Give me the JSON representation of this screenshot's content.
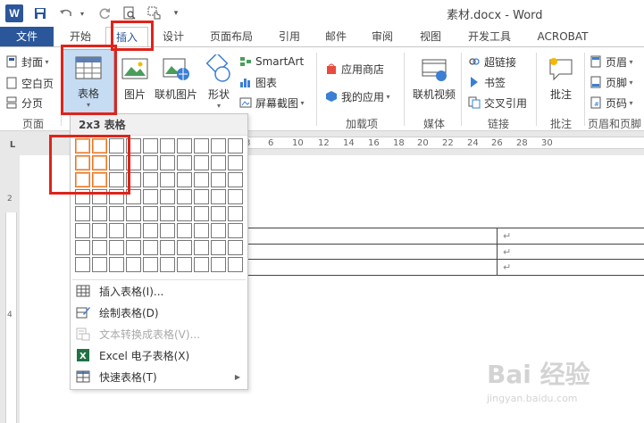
{
  "titlebar": {
    "logo": "W",
    "title": "素材.docx - Word",
    "qat": [
      "save-icon",
      "undo-icon",
      "redo-icon",
      "print-preview-icon",
      "touch-mode-icon",
      "customize-qat-icon"
    ]
  },
  "tabs": [
    {
      "id": "file",
      "label": "文件"
    },
    {
      "id": "home",
      "label": "开始"
    },
    {
      "id": "insert",
      "label": "插入"
    },
    {
      "id": "design",
      "label": "设计"
    },
    {
      "id": "layout",
      "label": "页面布局"
    },
    {
      "id": "references",
      "label": "引用"
    },
    {
      "id": "mailings",
      "label": "邮件"
    },
    {
      "id": "review",
      "label": "审阅"
    },
    {
      "id": "view",
      "label": "视图"
    },
    {
      "id": "developer",
      "label": "开发工具"
    },
    {
      "id": "acrobat",
      "label": "ACROBAT"
    }
  ],
  "ribbon": {
    "pages": {
      "cover": "封面",
      "blank": "空白页",
      "break": "分页",
      "label": "页面"
    },
    "table": {
      "label": "表格"
    },
    "illustrations": {
      "picture": "图片",
      "online_picture": "联机图片",
      "shapes": "形状",
      "smartart": "SmartArt",
      "chart": "图表",
      "screenshot": "屏幕截图"
    },
    "addins": {
      "store": "应用商店",
      "my_apps": "我的应用",
      "label": "加载项"
    },
    "media": {
      "online_video": "联机视频",
      "label": "媒体"
    },
    "links": {
      "hyperlink": "超链接",
      "bookmark": "书签",
      "cross_ref": "交叉引用",
      "label": "链接"
    },
    "comments": {
      "comment": "批注",
      "label": "批注"
    },
    "header_footer": {
      "header": "页眉",
      "footer": "页脚",
      "page_number": "页码",
      "label": "页眉和页脚"
    }
  },
  "dropdown": {
    "header": "2x3 表格",
    "rows_selected": 3,
    "cols_selected": 2,
    "items": [
      {
        "label": "插入表格(I)...",
        "icon": "insert-table-icon",
        "disabled": false,
        "submenu": false
      },
      {
        "label": "绘制表格(D)",
        "icon": "draw-table-icon",
        "disabled": false,
        "submenu": false
      },
      {
        "label": "文本转换成表格(V)...",
        "icon": "text-to-table-icon",
        "disabled": true,
        "submenu": false
      },
      {
        "label": "Excel 电子表格(X)",
        "icon": "excel-icon",
        "disabled": false,
        "submenu": false
      },
      {
        "label": "快速表格(T)",
        "icon": "quick-table-icon",
        "disabled": false,
        "submenu": true
      }
    ]
  },
  "ruler": {
    "corner": "L",
    "h_numbers": [
      "8",
      "6",
      "10",
      "12",
      "14",
      "16",
      "18",
      "20",
      "22",
      "24",
      "26",
      "28",
      "30"
    ],
    "v_numbers": [
      "2",
      "4"
    ]
  },
  "document": {
    "para_mark": "↵"
  },
  "watermark": {
    "text": "Bai 经验",
    "url": "jingyan.baidu.com"
  },
  "colors": {
    "accent": "#2b579a",
    "highlight": "#e0231a",
    "grid_selected": "#e87722"
  }
}
